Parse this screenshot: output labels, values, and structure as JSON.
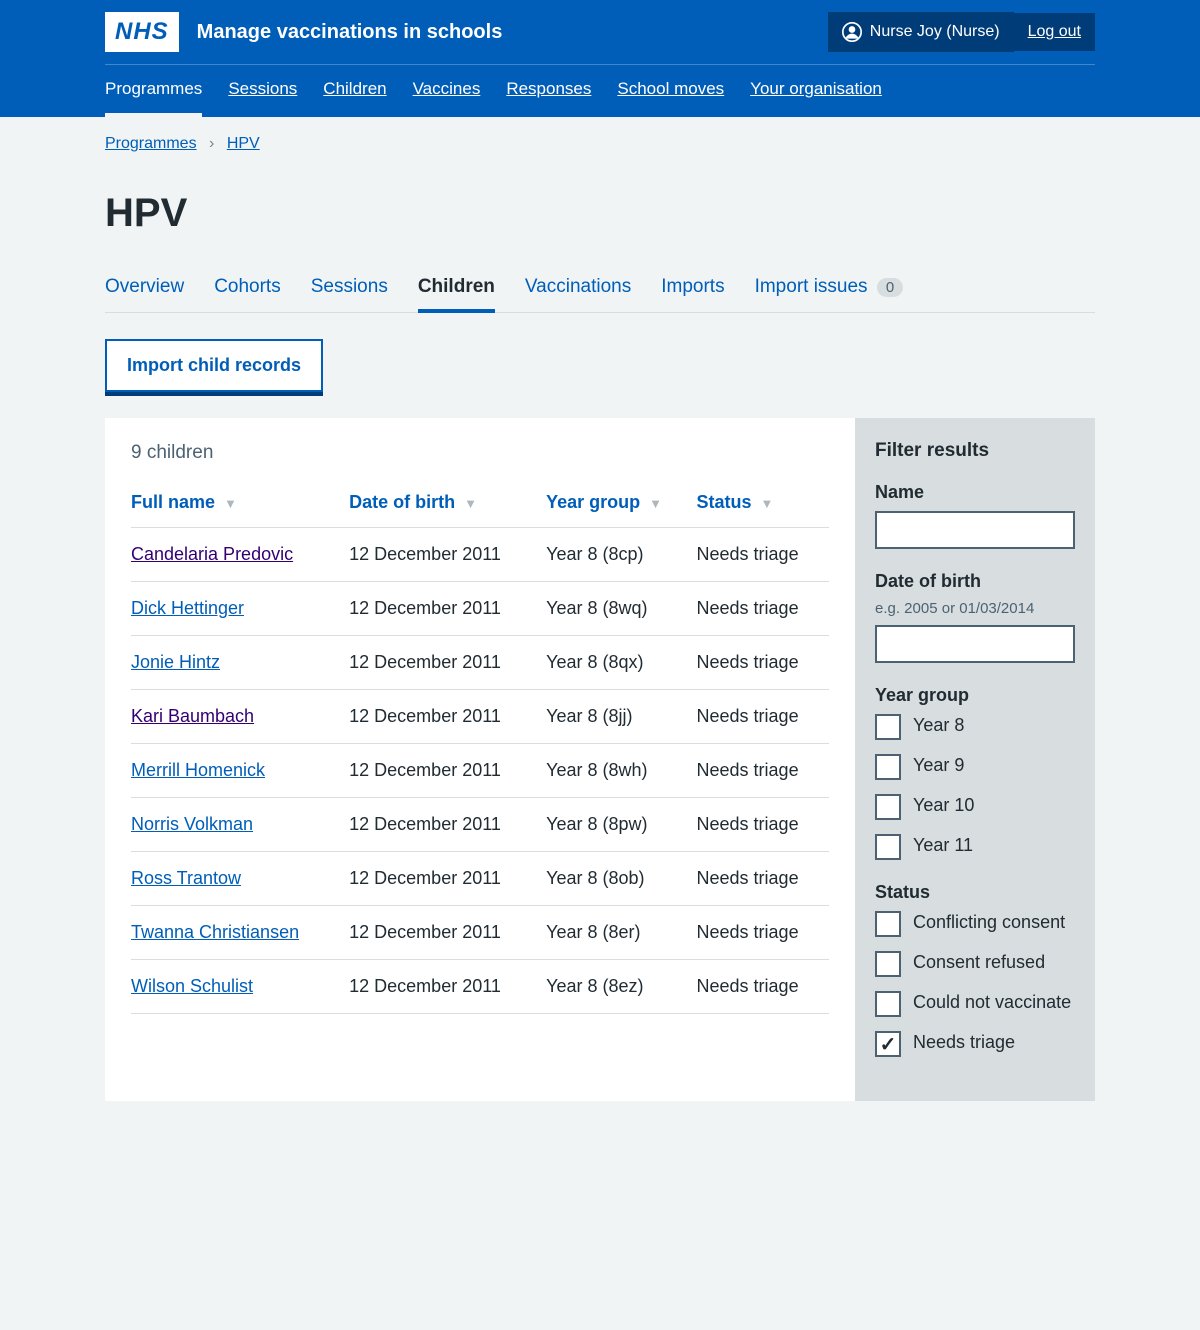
{
  "header": {
    "logo_text": "NHS",
    "service_name": "Manage vaccinations in schools",
    "user_name": "Nurse Joy (Nurse)",
    "logout_label": "Log out"
  },
  "nav": {
    "items": [
      {
        "label": "Programmes",
        "active": true
      },
      {
        "label": "Sessions"
      },
      {
        "label": "Children"
      },
      {
        "label": "Vaccines"
      },
      {
        "label": "Responses"
      },
      {
        "label": "School moves"
      },
      {
        "label": "Your organisation"
      }
    ]
  },
  "breadcrumbs": {
    "items": [
      {
        "label": "Programmes"
      },
      {
        "label": "HPV"
      }
    ],
    "sep": "›"
  },
  "page_title": "HPV",
  "sub_tabs": [
    {
      "label": "Overview"
    },
    {
      "label": "Cohorts"
    },
    {
      "label": "Sessions"
    },
    {
      "label": "Children",
      "active": true
    },
    {
      "label": "Vaccinations"
    },
    {
      "label": "Imports"
    },
    {
      "label": "Import issues",
      "badge": "0"
    }
  ],
  "import_button": "Import child records",
  "results_count": "9 children",
  "columns": [
    {
      "label": "Full name"
    },
    {
      "label": "Date of birth"
    },
    {
      "label": "Year group"
    },
    {
      "label": "Status"
    }
  ],
  "rows": [
    {
      "name": "Candelaria Predovic",
      "dob": "12 December 2011",
      "year": "Year 8 (8cp)",
      "status": "Needs triage",
      "visited": true
    },
    {
      "name": "Dick Hettinger",
      "dob": "12 December 2011",
      "year": "Year 8 (8wq)",
      "status": "Needs triage"
    },
    {
      "name": "Jonie Hintz",
      "dob": "12 December 2011",
      "year": "Year 8 (8qx)",
      "status": "Needs triage"
    },
    {
      "name": "Kari Baumbach",
      "dob": "12 December 2011",
      "year": "Year 8 (8jj)",
      "status": "Needs triage",
      "visited": true
    },
    {
      "name": "Merrill Homenick",
      "dob": "12 December 2011",
      "year": "Year 8 (8wh)",
      "status": "Needs triage"
    },
    {
      "name": "Norris Volkman",
      "dob": "12 December 2011",
      "year": "Year 8 (8pw)",
      "status": "Needs triage"
    },
    {
      "name": "Ross Trantow",
      "dob": "12 December 2011",
      "year": "Year 8 (8ob)",
      "status": "Needs triage"
    },
    {
      "name": "Twanna Christiansen",
      "dob": "12 December 2011",
      "year": "Year 8 (8er)",
      "status": "Needs triage"
    },
    {
      "name": "Wilson Schulist",
      "dob": "12 December 2011",
      "year": "Year 8 (8ez)",
      "status": "Needs triage"
    }
  ],
  "filters": {
    "title": "Filter results",
    "name_label": "Name",
    "dob_label": "Date of birth",
    "dob_hint": "e.g. 2005 or 01/03/2014",
    "year_group_label": "Year group",
    "year_group_options": [
      {
        "label": "Year 8"
      },
      {
        "label": "Year 9"
      },
      {
        "label": "Year 10"
      },
      {
        "label": "Year 11"
      }
    ],
    "status_label": "Status",
    "status_options": [
      {
        "label": "Conflicting consent"
      },
      {
        "label": "Consent refused"
      },
      {
        "label": "Could not vaccinate"
      },
      {
        "label": "Needs triage",
        "checked": true
      }
    ]
  }
}
